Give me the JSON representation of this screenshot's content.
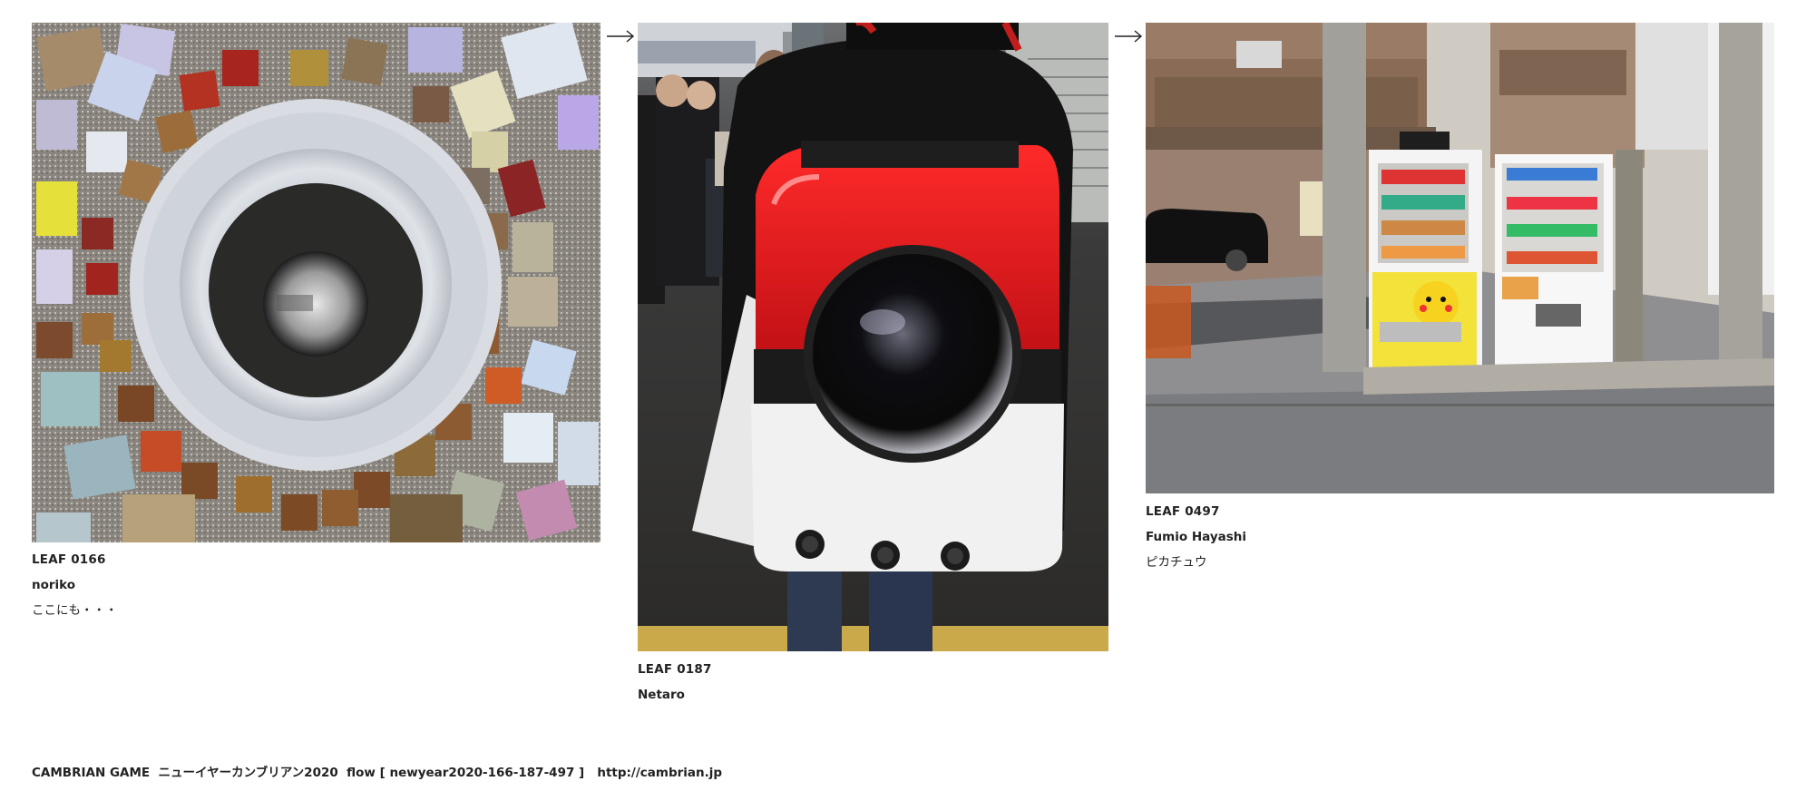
{
  "leaves": [
    {
      "leaf_id": "LEAF 0166",
      "author": "noriko",
      "title": "ここにも・・・"
    },
    {
      "leaf_id": "LEAF 0187",
      "author": "Netaro",
      "title": ""
    },
    {
      "leaf_id": "LEAF 0497",
      "author": "Fumio Hayashi",
      "title": "ピカチュウ"
    }
  ],
  "footer": {
    "text": "CAMBRIAN GAME  ニューイヤーカンブリアン2020  flow [ newyear2020-166-187-497 ]   ",
    "link": "http://cambrian.jp"
  },
  "icons": [
    "right-arrow-icon",
    "right-arrow-icon"
  ]
}
